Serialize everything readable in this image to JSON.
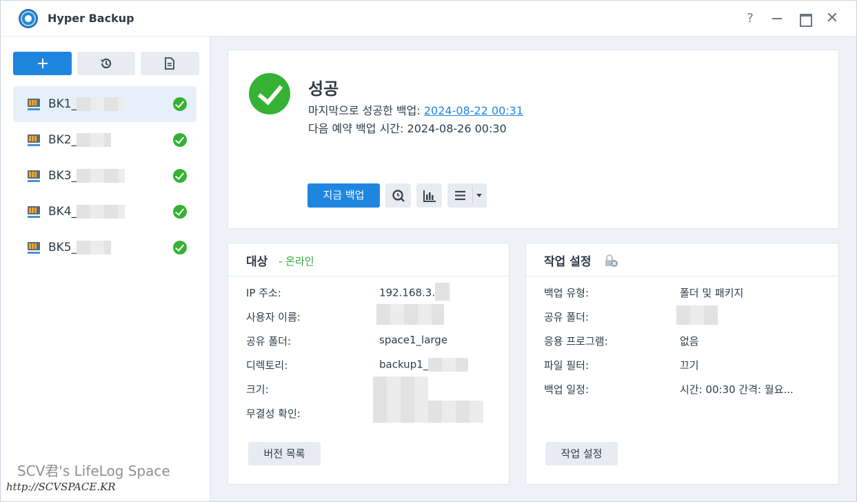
{
  "window": {
    "title": "Hyper Backup",
    "help_label": "?",
    "close_label": "✕"
  },
  "sidebar": {
    "tasks": [
      {
        "label": "BK1_",
        "status": "success"
      },
      {
        "label": "BK2_",
        "status": "success"
      },
      {
        "label": "BK3_",
        "status": "success"
      },
      {
        "label": "BK4_",
        "status": "success"
      },
      {
        "label": "BK5_",
        "status": "success"
      }
    ]
  },
  "watermark": {
    "line1": "SCV君's LifeLog Space",
    "line2": "http://SCVSPACE.KR"
  },
  "status": {
    "title": "성공",
    "last_success_label": "마지막으로 성공한 백업:",
    "last_success_value": "2024-08-22 00:31",
    "next_backup_label": "다음 예약 백업 시간:",
    "next_backup_value": "2024-08-26 00:30",
    "backup_now_label": "지금 백업"
  },
  "target": {
    "title": "대상",
    "state": "- 온라인",
    "rows": [
      {
        "label": "IP 주소:",
        "value": "192.168.3."
      },
      {
        "label": "사용자 이름:",
        "value": ""
      },
      {
        "label": "공유 폴더:",
        "value": "space1_large"
      },
      {
        "label": "디렉토리:",
        "value": "backup1_"
      },
      {
        "label": "크기:",
        "value": ""
      },
      {
        "label": "무결성 확인:",
        "value": ""
      }
    ],
    "version_list_label": "버전 목록"
  },
  "task_settings": {
    "title": "작업 설정",
    "rows": [
      {
        "label": "백업 유형:",
        "value": "폴더 및 패키지"
      },
      {
        "label": "공유 폴더:",
        "value": ""
      },
      {
        "label": "응용 프로그램:",
        "value": "없음"
      },
      {
        "label": "파일 필터:",
        "value": "끄기"
      },
      {
        "label": "백업 일정:",
        "value": "시간: 00:30 간격: 월요..."
      }
    ],
    "settings_button_label": "작업 설정"
  },
  "colors": {
    "accent": "#1f86e0",
    "success": "#35b233",
    "online": "#35a133"
  },
  "icons": [
    "app-icon",
    "add-icon",
    "history-icon",
    "log-icon",
    "nas-icon",
    "check-icon",
    "search-icon",
    "stats-icon",
    "menu-icon",
    "lock-icon"
  ]
}
